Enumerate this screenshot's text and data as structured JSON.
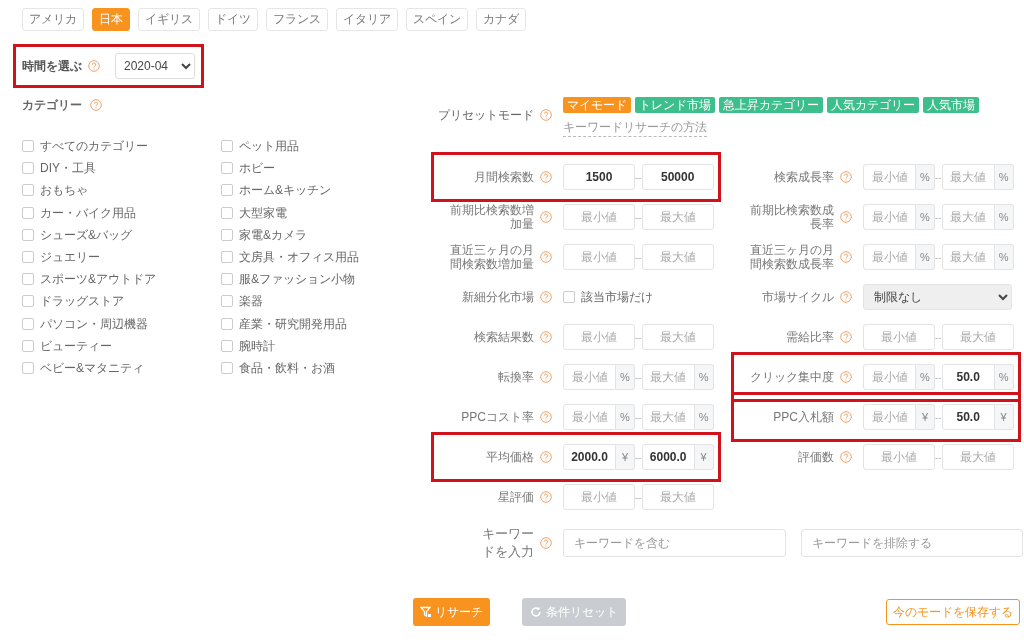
{
  "countries": [
    {
      "label": "アメリカ",
      "selected": false
    },
    {
      "label": "日本",
      "selected": true
    },
    {
      "label": "イギリス",
      "selected": false
    },
    {
      "label": "ドイツ",
      "selected": false
    },
    {
      "label": "フランス",
      "selected": false
    },
    {
      "label": "イタリア",
      "selected": false
    },
    {
      "label": "スペイン",
      "selected": false
    },
    {
      "label": "カナダ",
      "selected": false
    }
  ],
  "period": {
    "label": "時間を選ぶ",
    "value": "2020-04",
    "highlighted": true
  },
  "categories": {
    "title": "カテゴリー",
    "columns": [
      [
        {
          "label": "すべてのカテゴリー",
          "checked": false
        },
        {
          "label": "DIY・工具",
          "checked": false
        },
        {
          "label": "おもちゃ",
          "checked": false
        },
        {
          "label": "カー・バイク用品",
          "checked": false
        },
        {
          "label": "シューズ&バッグ",
          "checked": false
        },
        {
          "label": "ジュエリー",
          "checked": false
        },
        {
          "label": "スポーツ&アウトドア",
          "checked": false
        },
        {
          "label": "ドラッグストア",
          "checked": false
        },
        {
          "label": "パソコン・周辺機器",
          "checked": false
        },
        {
          "label": "ビューティー",
          "checked": false
        },
        {
          "label": "ベビー&マタニティ",
          "checked": false
        }
      ],
      [
        {
          "label": "ペット用品",
          "checked": false
        },
        {
          "label": "ホビー",
          "checked": false
        },
        {
          "label": "ホーム&キッチン",
          "checked": false
        },
        {
          "label": "大型家電",
          "checked": false
        },
        {
          "label": "家電&カメラ",
          "checked": false
        },
        {
          "label": "文房具・オフィス用品",
          "checked": false
        },
        {
          "label": "服&ファッション小物",
          "checked": false
        },
        {
          "label": "楽器",
          "checked": false
        },
        {
          "label": "産業・研究開発用品",
          "checked": false
        },
        {
          "label": "腕時計",
          "checked": false
        },
        {
          "label": "食品・飲料・お酒",
          "checked": false
        }
      ]
    ]
  },
  "preset": {
    "label": "プリセットモード",
    "tags": [
      {
        "label": "マイモード",
        "color": "#f7931e"
      },
      {
        "label": "トレンド市場",
        "color": "#3dbf8d"
      },
      {
        "label": "急上昇カテゴリー",
        "color": "#3dbf8d"
      },
      {
        "label": "人気カテゴリー",
        "color": "#3dbf8d"
      },
      {
        "label": "人気市場",
        "color": "#3dbf8d"
      }
    ],
    "link": "キーワードリサーチの方法"
  },
  "filter_rows": [
    {
      "left": {
        "kind": "range",
        "label": "月間検索数",
        "highlighted": true,
        "separator": "--",
        "min": {
          "value": "1500"
        },
        "max": {
          "value": "50000"
        }
      },
      "right": {
        "kind": "range",
        "label": "検索成長率",
        "highlighted": false,
        "separator": "--",
        "min": {
          "placeholder": "最小値",
          "unit": "%"
        },
        "max": {
          "placeholder": "最大値",
          "unit": "%"
        }
      }
    },
    {
      "left": {
        "kind": "range",
        "label": "前期比検索数増加量",
        "highlighted": false,
        "separator": "--",
        "min": {
          "placeholder": "最小値"
        },
        "max": {
          "placeholder": "最大値"
        }
      },
      "right": {
        "kind": "range",
        "label": "前期比検索数成長率",
        "highlighted": false,
        "separator": "--",
        "min": {
          "placeholder": "最小値",
          "unit": "%"
        },
        "max": {
          "placeholder": "最大値",
          "unit": "%"
        }
      }
    },
    {
      "left": {
        "kind": "range",
        "label": "直近三ヶ月の月間検索数増加量",
        "highlighted": false,
        "separator": "--",
        "min": {
          "placeholder": "最小値"
        },
        "max": {
          "placeholder": "最大値"
        }
      },
      "right": {
        "kind": "range",
        "label": "直近三ヶ月の月間検索数成長率",
        "highlighted": false,
        "separator": "--",
        "min": {
          "placeholder": "最小値",
          "unit": "%"
        },
        "max": {
          "placeholder": "最大値",
          "unit": "%"
        }
      }
    },
    {
      "left": {
        "kind": "checkbox",
        "label": "新細分化市場",
        "highlighted": false,
        "option": "該当市場だけ",
        "checked": false
      },
      "right": {
        "kind": "select",
        "label": "市場サイクル",
        "highlighted": false,
        "value": "制限なし"
      }
    },
    {
      "left": {
        "kind": "range",
        "label": "検索結果数",
        "highlighted": false,
        "separator": "--",
        "min": {
          "placeholder": "最小値"
        },
        "max": {
          "placeholder": "最大値"
        }
      },
      "right": {
        "kind": "range",
        "label": "需給比率",
        "highlighted": false,
        "separator": "--",
        "min": {
          "placeholder": "最小値"
        },
        "max": {
          "placeholder": "最大値"
        }
      }
    },
    {
      "left": {
        "kind": "range",
        "label": "転換率",
        "highlighted": false,
        "separator": "--",
        "min": {
          "placeholder": "最小値",
          "unit": "%"
        },
        "max": {
          "placeholder": "最大値",
          "unit": "%"
        }
      },
      "right": {
        "kind": "range",
        "label": "クリック集中度",
        "highlighted": true,
        "separator": "--",
        "min": {
          "placeholder": "最小値",
          "unit": "%"
        },
        "max": {
          "value": "50.0",
          "unit": "%"
        }
      }
    },
    {
      "left": {
        "kind": "range",
        "label": "PPCコスト率",
        "highlighted": false,
        "separator": "--",
        "min": {
          "placeholder": "最小値",
          "unit": "%"
        },
        "max": {
          "placeholder": "最大値",
          "unit": "%"
        }
      },
      "right": {
        "kind": "range",
        "label": "PPC入札額",
        "highlighted": true,
        "separator": "--",
        "min": {
          "placeholder": "最小値",
          "unit": "¥"
        },
        "max": {
          "value": "50.0",
          "unit": "¥"
        }
      }
    },
    {
      "left": {
        "kind": "range",
        "label": "平均価格",
        "highlighted": true,
        "separator": "--",
        "min": {
          "value": "2000.0",
          "unit": "¥"
        },
        "max": {
          "value": "6000.0",
          "unit": "¥"
        }
      },
      "right": {
        "kind": "range",
        "label": "評価数",
        "highlighted": false,
        "separator": "--",
        "min": {
          "placeholder": "最小値"
        },
        "max": {
          "placeholder": "最大値"
        }
      }
    },
    {
      "left": {
        "kind": "range",
        "label": "星評価",
        "highlighted": false,
        "separator": "--",
        "min": {
          "placeholder": "最小値"
        },
        "max": {
          "placeholder": "最大値"
        }
      }
    }
  ],
  "keyword": {
    "label": "キーワードを入力",
    "include_placeholder": "キーワードを含む",
    "exclude_placeholder": "キーワードを排除する"
  },
  "buttons": {
    "research": {
      "label": "リサーチ",
      "disabled": false
    },
    "reset": {
      "label": "条件リセット",
      "disabled": true
    },
    "save": {
      "label": "今のモードを保存する"
    }
  }
}
